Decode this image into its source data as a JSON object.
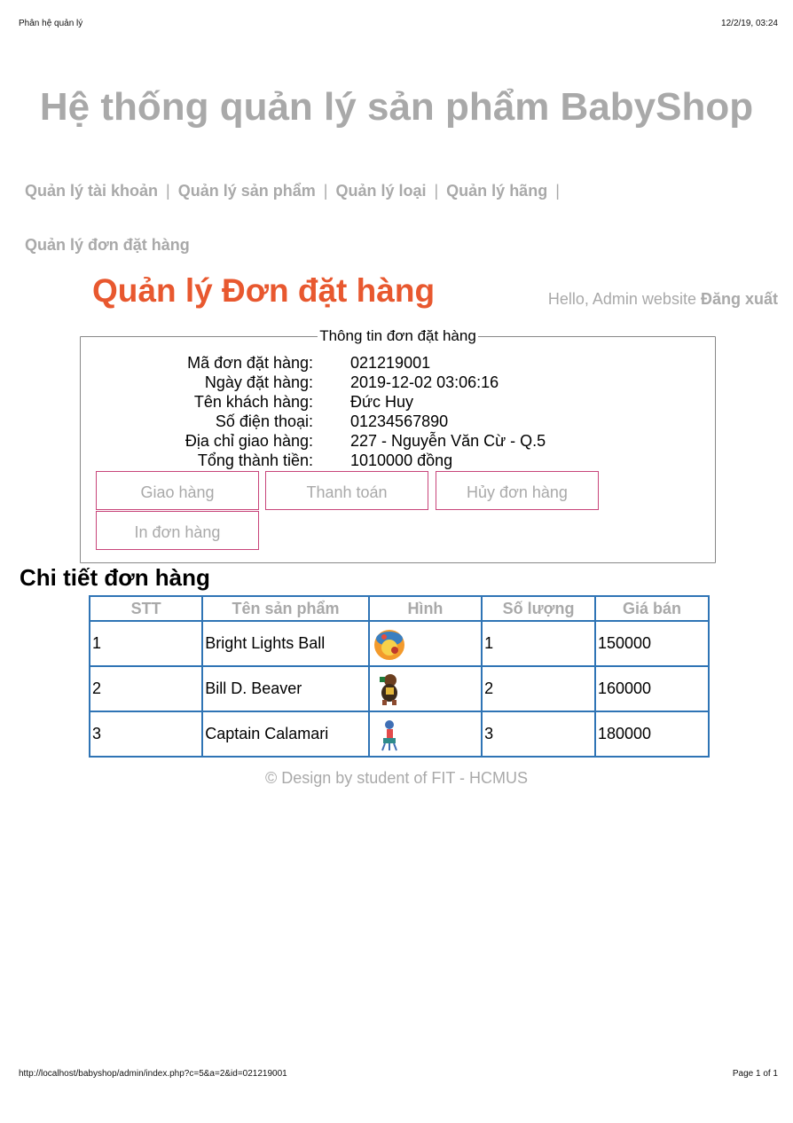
{
  "print": {
    "page_title": "Phân hệ quản lý",
    "datetime": "12/2/19, 03:24",
    "url": "http://localhost/babyshop/admin/index.php?c=5&a=2&id=021219001",
    "page_number": "Page 1 of 1"
  },
  "site_title": "Hệ thống quản lý sản phẩm BabyShop",
  "nav": {
    "items": [
      {
        "label": "Quản lý tài khoản"
      },
      {
        "label": "Quản lý sản phẩm"
      },
      {
        "label": "Quản lý loại"
      },
      {
        "label": "Quản lý hãng"
      },
      {
        "label": "Quản lý đơn đặt hàng"
      }
    ],
    "separator": "|"
  },
  "page_heading": "Quản lý Đơn đặt hàng",
  "greeting": {
    "text": "Hello, Admin website",
    "logout": "Đăng xuất"
  },
  "order_info": {
    "legend": "Thông tin đơn đặt hàng",
    "rows": [
      {
        "label": "Mã đơn đặt hàng:",
        "value": "021219001"
      },
      {
        "label": "Ngày đặt hàng:",
        "value": "2019-12-02 03:06:16"
      },
      {
        "label": "Tên khách hàng:",
        "value": "Đức Huy"
      },
      {
        "label": "Số điện thoại:",
        "value": "01234567890"
      },
      {
        "label": "Địa chỉ giao hàng:",
        "value": "227 - Nguyễn Văn Cừ - Q.5"
      },
      {
        "label": "Tổng thành tiền:",
        "value": "1010000 đồng"
      }
    ],
    "buttons": {
      "deliver": "Giao hàng",
      "pay": "Thanh toán",
      "cancel": "Hủy đơn hàng",
      "print": "In đơn hàng"
    }
  },
  "detail": {
    "heading": "Chi tiết đơn hàng",
    "columns": [
      "STT",
      "Tên sản phẩm",
      "Hình",
      "Số lượng",
      "Giá bán"
    ],
    "rows": [
      {
        "stt": "1",
        "name": "Bright Lights Ball",
        "qty": "1",
        "price": "150000"
      },
      {
        "stt": "2",
        "name": "Bill D. Beaver",
        "qty": "2",
        "price": "160000"
      },
      {
        "stt": "3",
        "name": "Captain Calamari",
        "qty": "3",
        "price": "180000"
      }
    ]
  },
  "footer": "© Design by student of FIT - HCMUS",
  "colors": {
    "heading_accent": "#e8582f",
    "muted_text": "#a9a9a9",
    "table_border": "#2f74b5",
    "button_border": "#c8457a"
  }
}
